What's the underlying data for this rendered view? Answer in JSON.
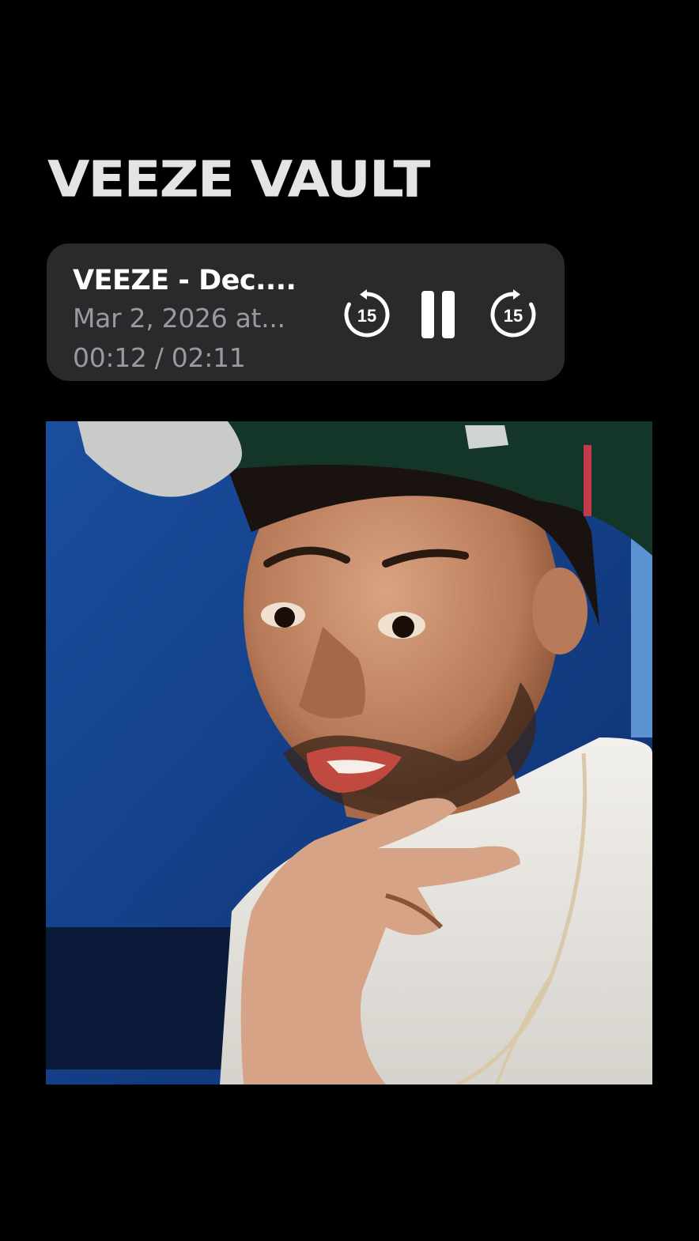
{
  "header": {
    "title": "VEEZE VAULT"
  },
  "player": {
    "track_title": "VEEZE - Dec....",
    "track_date": "Mar 2, 2026 at...",
    "elapsed": "00:12",
    "duration": "02:11",
    "time_display": "00:12 / 02:11",
    "skip_back_label": "15",
    "skip_forward_label": "15",
    "state": "playing"
  },
  "artwork": {
    "icon": "cover-photo"
  },
  "colors": {
    "background": "#000000",
    "card": "#2a2a2d",
    "title": "#e4e4e6",
    "secondary_text": "#9a9a9e"
  }
}
